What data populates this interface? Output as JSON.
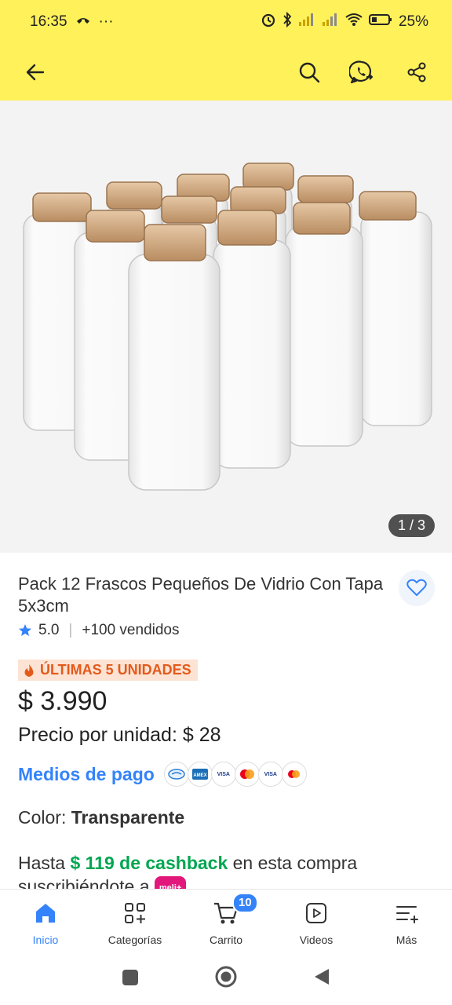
{
  "status_bar": {
    "time": "16:35",
    "extra": "···",
    "battery": "25%"
  },
  "gallery": {
    "counter": "1 / 3"
  },
  "product": {
    "title": "Pack 12 Frascos Pequeños De Vidrio Con Tapa 5x3cm",
    "rating": "5.0",
    "sold": "+100 vendidos",
    "badge": "ÚLTIMAS 5 UNIDADES",
    "price": "$ 3.990",
    "unit_price_label": "Precio por unidad:",
    "unit_price_value": "$ 28",
    "payment_link": "Medios de pago",
    "payment_cards": [
      "mercadopago",
      "AMEX",
      "VISA",
      "mastercard",
      "VISA",
      "mastercard"
    ],
    "color_label": "Color:",
    "color_value": "Transparente",
    "cashback_prefix": "Hasta",
    "cashback_amount": "$ 119 de cashback",
    "cashback_suffix": "en esta compra suscribiéndote a",
    "meli_badge": "meli+"
  },
  "bottom_nav": {
    "items": [
      {
        "label": "Inicio",
        "icon": "home-icon"
      },
      {
        "label": "Categorías",
        "icon": "categories-icon"
      },
      {
        "label": "Carrito",
        "icon": "cart-icon",
        "badge": "10"
      },
      {
        "label": "Videos",
        "icon": "video-icon"
      },
      {
        "label": "Más",
        "icon": "more-icon"
      }
    ]
  },
  "colors": {
    "brand_yellow": "#fff159",
    "accent_blue": "#3483fa",
    "green": "#00a650",
    "orange": "#e35a1b"
  }
}
